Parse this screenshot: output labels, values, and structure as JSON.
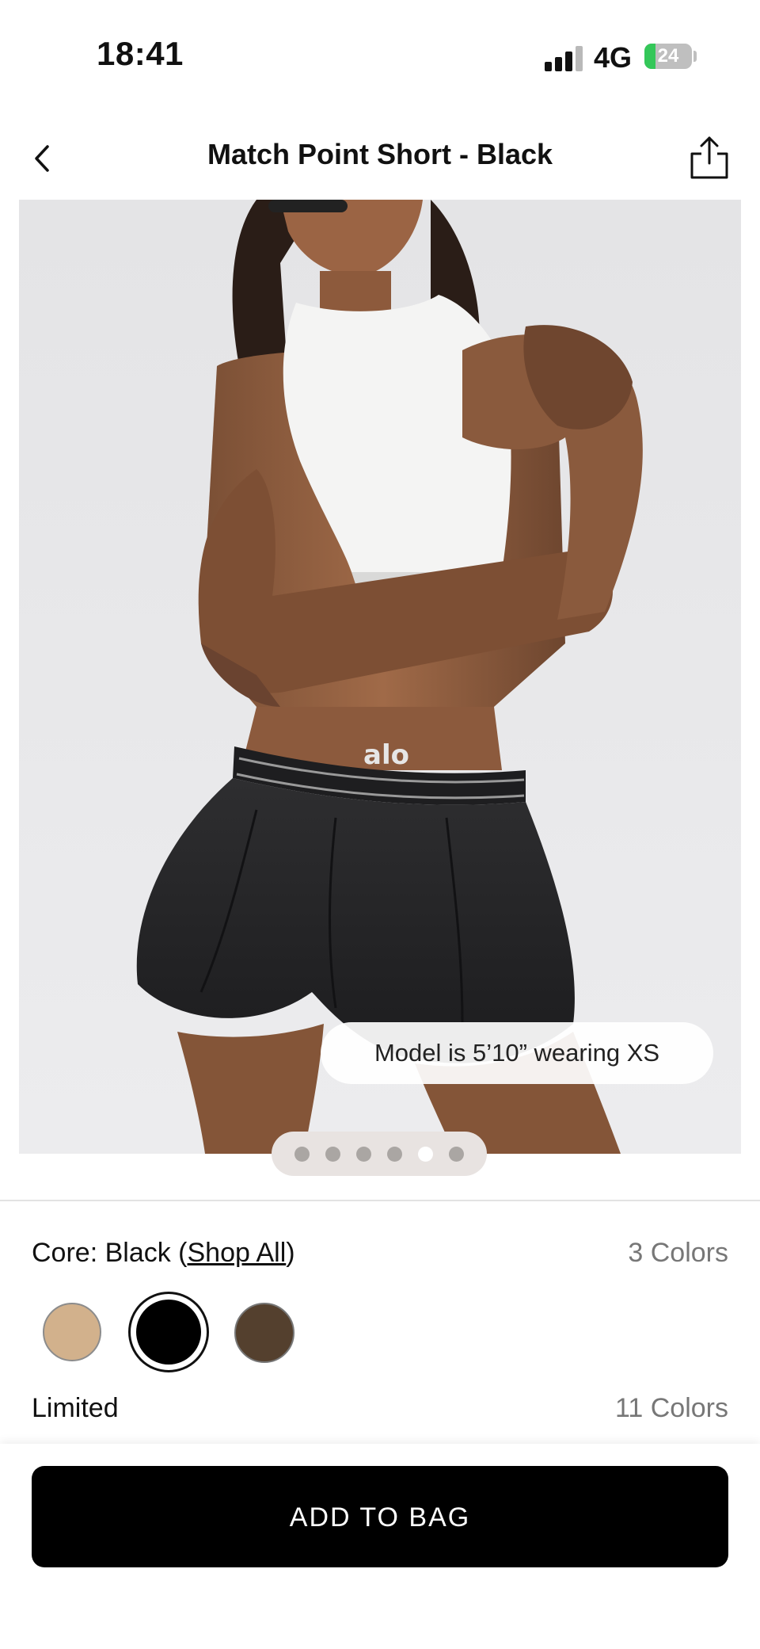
{
  "status_bar": {
    "time": "18:41",
    "network": "4G",
    "battery": "24",
    "battery_level": 0.24
  },
  "header": {
    "title": "Match Point Short - Black",
    "back_icon": "chevron-left-icon",
    "share_icon": "share-icon"
  },
  "gallery": {
    "size_note": "Model is 5’10” wearing XS",
    "dot_count": 6,
    "active_dot": 5,
    "brand_mark": "alo"
  },
  "colors": {
    "core_prefix": "Core: Black (",
    "shop_all": "Shop All",
    "core_suffix": ")",
    "core_count": "3 Colors",
    "swatches": [
      {
        "name": "tan",
        "hex": "#d2b18c",
        "selected": false
      },
      {
        "name": "black",
        "hex": "#000000",
        "selected": true
      },
      {
        "name": "brown",
        "hex": "#54402e",
        "selected": false
      }
    ],
    "limited_label": "Limited",
    "limited_count": "11 Colors"
  },
  "cta": {
    "add_to_bag": "ADD TO BAG"
  }
}
